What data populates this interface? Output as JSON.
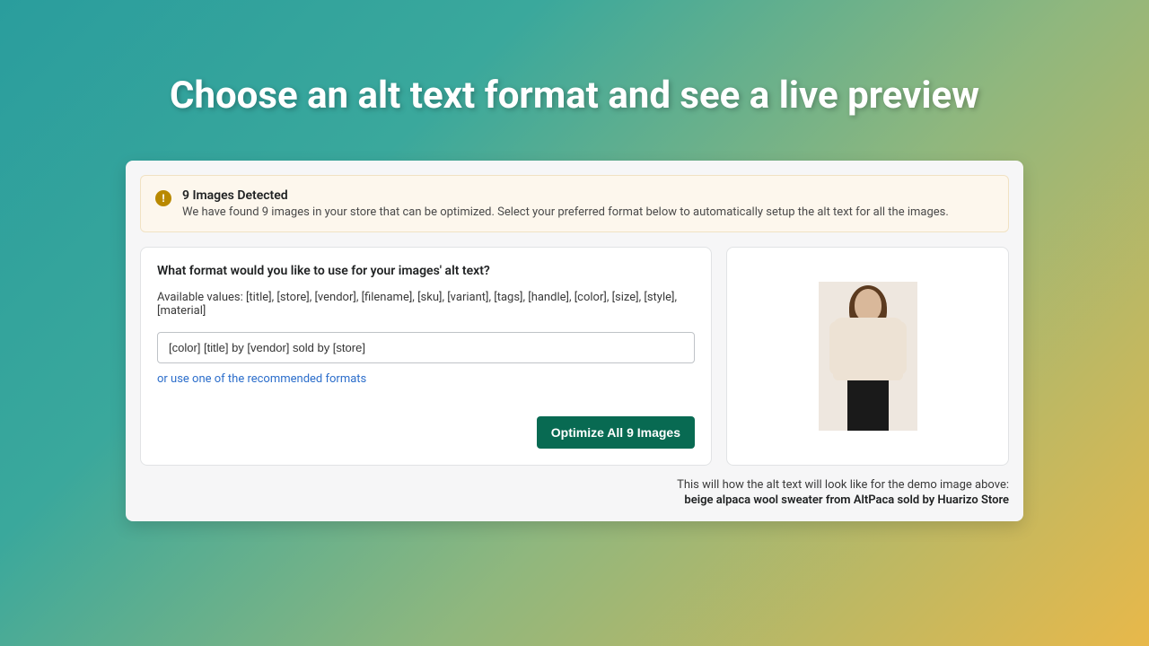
{
  "page_title": "Choose an alt text format and see a live preview",
  "alert": {
    "title": "9 Images Detected",
    "body": "We have found 9 images in your store that can be optimized. Select your preferred format below to automatically setup the alt text for all the images."
  },
  "format": {
    "question": "What format would you like to use for your images' alt text?",
    "available_label": "Available values: [title], [store], [vendor], [filename], [sku], [variant], [tags], [handle], [color], [size], [style], [material]",
    "value": "[color] [title] by [vendor] sold by [store]",
    "recommended_link": "or use one of the recommended formats",
    "optimize_button": "Optimize All 9 Images"
  },
  "preview": {
    "caption_intro": "This will how the alt text will look like for the demo image above:",
    "caption_result": "beige alpaca wool sweater from AltPaca sold by Huarizo Store"
  }
}
